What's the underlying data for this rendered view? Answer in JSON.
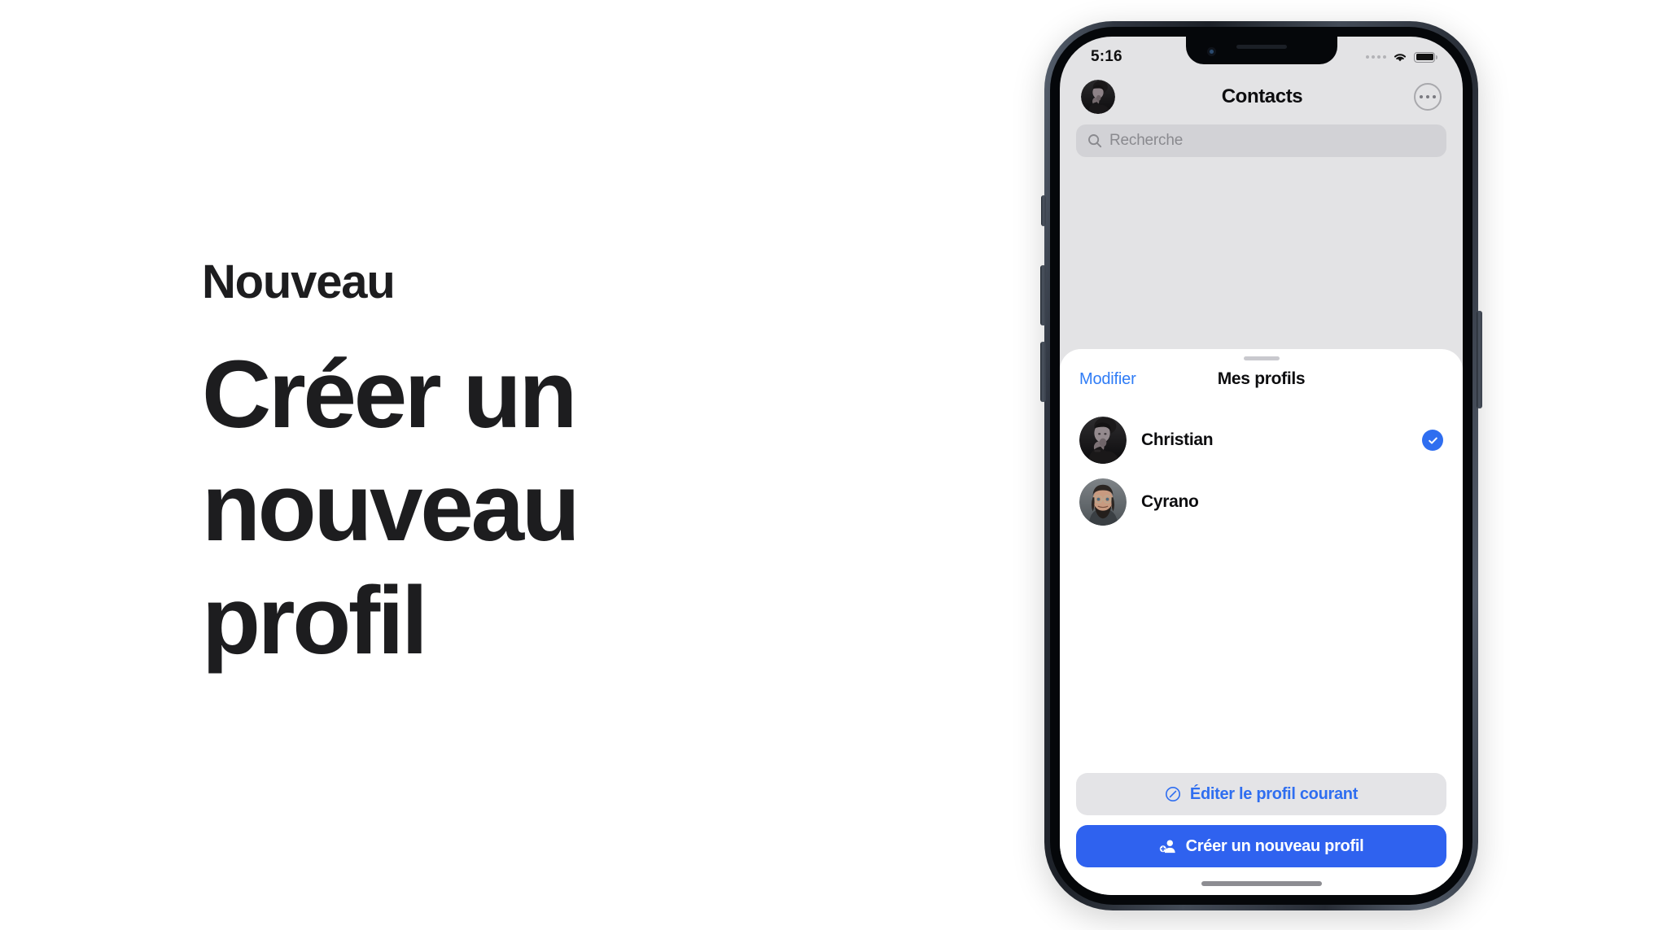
{
  "marketing": {
    "eyebrow": "Nouveau",
    "headline": "Créer un nouveau profil"
  },
  "phone": {
    "status_bar": {
      "time": "5:16",
      "cellular_icon": "cellular-dots-icon",
      "wifi_icon": "wifi-icon",
      "battery_icon": "battery-full-icon"
    },
    "app": {
      "header": {
        "avatar": "user-avatar",
        "title": "Contacts",
        "more_icon": "more-ellipsis-icon"
      },
      "search": {
        "icon": "search-icon",
        "placeholder": "Recherche",
        "value": ""
      }
    },
    "sheet": {
      "grabber": "sheet-grabber",
      "edit_label": "Modifier",
      "title": "Mes profils",
      "profiles": [
        {
          "name": "Christian",
          "selected": true,
          "avatar": "christian-avatar"
        },
        {
          "name": "Cyrano",
          "selected": false,
          "avatar": "cyrano-avatar"
        }
      ],
      "actions": {
        "edit_current": {
          "label": "Éditer le profil courant",
          "icon": "slash-circle-icon"
        },
        "create_new": {
          "label": "Créer un nouveau profil",
          "icon": "person-add-icon"
        }
      }
    },
    "home_indicator": "home-indicator"
  },
  "colors": {
    "accent_blue": "#2f62ef",
    "link_blue": "#2f7cf6",
    "check_blue": "#2f6ef0",
    "app_background": "#e3e3e5",
    "sheet_background": "#ffffff",
    "secondary_button": "#e4e4e7",
    "text_primary": "#1d1d1f"
  }
}
